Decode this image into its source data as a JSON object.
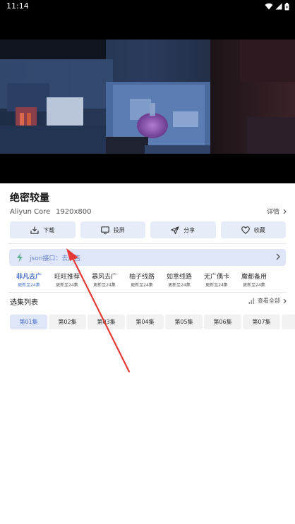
{
  "status_bar": {
    "time": "11:14"
  },
  "video": {
    "title": "绝密较量",
    "source": "Aliyun Core",
    "resolution": "1920x800",
    "detail_label": "详情"
  },
  "actions": [
    {
      "label": "下载",
      "icon": "download-icon"
    },
    {
      "label": "投屏",
      "icon": "cast-icon"
    },
    {
      "label": "分享",
      "icon": "share-icon"
    },
    {
      "label": "收藏",
      "icon": "heart-icon"
    }
  ],
  "json_bar": {
    "label": "json接口：去广告"
  },
  "routes": [
    {
      "name": "非凡去广",
      "sub": "更新至24集",
      "active": true
    },
    {
      "name": "旺旺推荐",
      "sub": "更新至24集"
    },
    {
      "name": "暴风去广",
      "sub": "更新至24集"
    },
    {
      "name": "柚子线路",
      "sub": "更新至24集"
    },
    {
      "name": "如意线路",
      "sub": "更新至24集"
    },
    {
      "name": "无广偶卡",
      "sub": "更新至24集"
    },
    {
      "name": "魔都备用",
      "sub": "更新至24集"
    }
  ],
  "episodes": {
    "title": "选集列表",
    "view_all": "查看全部",
    "items": [
      "第01集",
      "第02集",
      "第03集",
      "第04集",
      "第05集",
      "第06集",
      "第07集"
    ]
  },
  "colors": {
    "accent": "#4a72c8",
    "button_bg": "#e6ecf8",
    "annotation_arrow": "#e53935"
  }
}
